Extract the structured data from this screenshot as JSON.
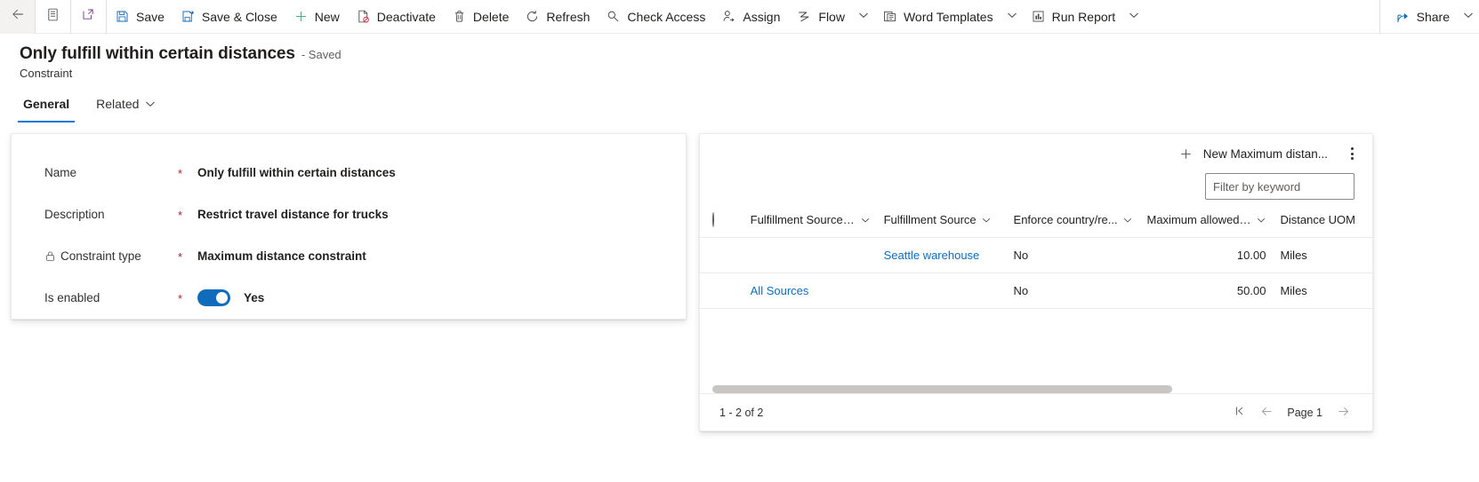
{
  "commandbar": {
    "back_icon": "back-arrow-icon",
    "form_selector_icon": "form-list-icon",
    "popout_icon": "open-in-new-window-icon",
    "buttons": [
      {
        "label": "Save",
        "icon": "save-icon"
      },
      {
        "label": "Save & Close",
        "icon": "save-and-close-icon"
      },
      {
        "label": "New",
        "icon": "plus-icon"
      },
      {
        "label": "Deactivate",
        "icon": "deactivate-icon"
      },
      {
        "label": "Delete",
        "icon": "trash-icon"
      },
      {
        "label": "Refresh",
        "icon": "refresh-icon"
      },
      {
        "label": "Check Access",
        "icon": "key-icon"
      },
      {
        "label": "Assign",
        "icon": "assign-person-icon"
      },
      {
        "label": "Flow",
        "icon": "flow-icon",
        "chevron": true
      },
      {
        "label": "Word Templates",
        "icon": "word-template-icon",
        "chevron": true
      },
      {
        "label": "Run Report",
        "icon": "report-icon",
        "chevron": true
      }
    ],
    "share": {
      "label": "Share",
      "icon": "share-icon",
      "chevron": true
    }
  },
  "header": {
    "title": "Only fulfill within certain distances",
    "saved_state": "- Saved",
    "entity": "Constraint"
  },
  "tabs": [
    {
      "label": "General",
      "selected": true,
      "chevron": false
    },
    {
      "label": "Related",
      "selected": false,
      "chevron": true
    }
  ],
  "form": {
    "fields": [
      {
        "label": "Name",
        "required": "*",
        "value": "Only fulfill within certain distances",
        "locked": false,
        "type": "text"
      },
      {
        "label": "Description",
        "required": "*",
        "value": "Restrict travel distance for trucks",
        "locked": false,
        "type": "text"
      },
      {
        "label": "Constraint type",
        "required": "*",
        "value": "Maximum distance constraint",
        "locked": true,
        "type": "text"
      },
      {
        "label": "Is enabled",
        "required": "*",
        "value": "Yes",
        "locked": false,
        "type": "toggle",
        "toggle_on": true
      }
    ]
  },
  "subgrid": {
    "new_record_label": "New Maximum distan...",
    "new_record_icon": "plus-icon",
    "overflow_icon": "more-vertical-icon",
    "filter": {
      "placeholder": "Filter by keyword",
      "value": ""
    },
    "select_all_icon": "select-all-circle-icon",
    "columns": [
      {
        "label": "Fulfillment Source ...",
        "sortable": true,
        "align": "left"
      },
      {
        "label": "Fulfillment Source",
        "sortable": true,
        "align": "left"
      },
      {
        "label": "Enforce country/re...",
        "sortable": true,
        "align": "left"
      },
      {
        "label": "Maximum allowed ...",
        "sortable": true,
        "align": "right"
      },
      {
        "label": "Distance UOM",
        "sortable": false,
        "align": "left"
      }
    ],
    "rows": [
      {
        "fulfillment_source_group": "",
        "fulfillment_source": "Seattle warehouse",
        "enforce_country": "No",
        "maximum_allowed": "10.00",
        "distance_uom": "Miles"
      },
      {
        "fulfillment_source_group": "All Sources",
        "fulfillment_source": "",
        "enforce_country": "No",
        "maximum_allowed": "50.00",
        "distance_uom": "Miles"
      }
    ],
    "footer": {
      "record_count": "1 - 2 of 2",
      "page_label": "Page 1",
      "first_page_icon": "first-page-icon",
      "previous_page_icon": "previous-page-icon",
      "next_page_icon": "next-page-icon"
    }
  },
  "colors": {
    "accent": "#0078d4",
    "link": "#0f6cbd",
    "required": "#a4262c",
    "toggle_on": "#0f6cbd",
    "border": "#edebe9"
  }
}
